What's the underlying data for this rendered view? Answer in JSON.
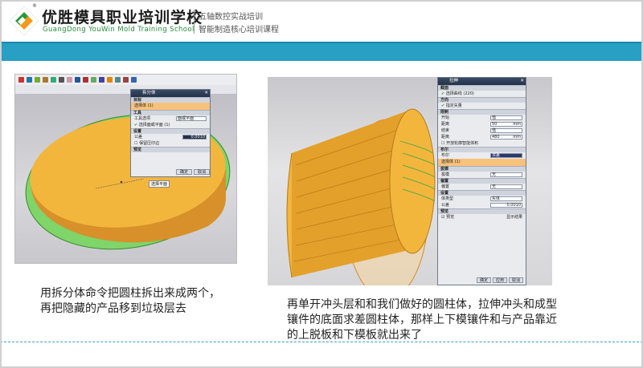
{
  "header": {
    "brand_name": "优胜模具职业培训学校",
    "brand_en": "GuangDong YouWin Mold Training School",
    "registered": "®",
    "tagline_1": "五轴数控实战培训",
    "tagline_2": "智能制造核心培训课程"
  },
  "left_panel": {
    "dialog_title": "拆分体",
    "section_target": "目标",
    "select_body": "选择体 (1)",
    "section_tool": "工具",
    "tool_option_label": "工具选项",
    "tool_option_value": "面或平面",
    "select_face": "选择面或平面 (1)",
    "section_settings": "设置",
    "tolerance_label": "公差",
    "tolerance_value": "0.0010",
    "keep_label": "保留压印边",
    "section_preview": "预览",
    "ok_label": "确定",
    "cancel_label": "取消",
    "tooltip": "选择平面",
    "caption": "用拆分体命令把圆柱拆出来成两个，再把隐藏的产品移到垃圾层去"
  },
  "right_panel": {
    "dialog_title": "拉伸",
    "section_profile": "截面",
    "select_curve": "选择曲线 (220)",
    "section_direction": "方向",
    "specify_vector": "指定矢量",
    "section_limits": "限制",
    "start_label": "开始",
    "start_type": "值",
    "start_dist_label": "距离",
    "start_dist": "50",
    "end_label": "结束",
    "end_type": "值",
    "end_dist_label": "距离",
    "end_dist": "480",
    "open_profile_label": "开放轮廓智能体积",
    "section_boolean": "布尔",
    "boolean_label": "布尔",
    "boolean_value": "求差",
    "select_body": "选择体 (1)",
    "section_draft": "拔模",
    "draft_label": "拔模",
    "draft_value": "无",
    "section_offset": "偏置",
    "offset_label": "偏置",
    "offset_value": "无",
    "section_settings": "设置",
    "body_type_label": "体类型",
    "body_type_value": "实体",
    "tolerance_label": "公差",
    "tolerance_value": "0.0010",
    "section_preview": "预览",
    "preview_label": "预览",
    "show_result": "显示结果",
    "ok_label": "确定",
    "apply_label": "应用",
    "cancel_label": "取消",
    "unit": "mm",
    "caption": "再单开冲头层和和我们做好的圆柱体，拉伸冲头和成型镶件的底面求差圆柱体，那样上下模镶件和与产品靠近的上脱板和下模板就出来了"
  },
  "colors": {
    "teal_band": "#27a0c4",
    "logo_green": "#2a9a3a",
    "logo_orange": "#f29a1c",
    "part_orange": "#f3b63c",
    "plane_green": "#7fd46a"
  }
}
